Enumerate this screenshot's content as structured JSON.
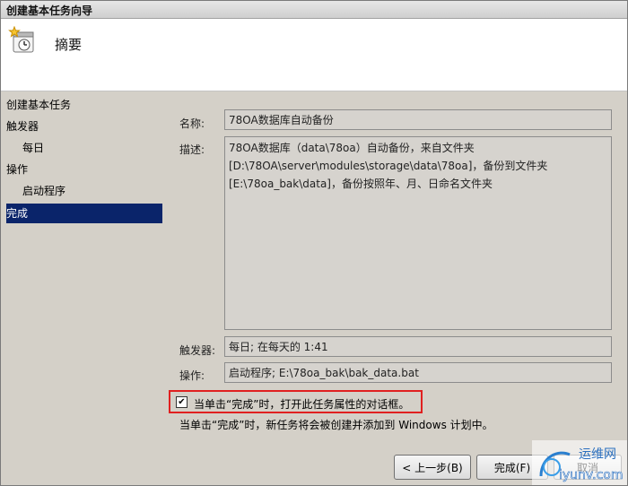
{
  "window": {
    "title": "创建基本任务向导"
  },
  "header": {
    "title": "摘要",
    "icon": "scheduled-task-wizard-icon"
  },
  "sidebar": {
    "items": [
      {
        "label": "创建基本任务"
      },
      {
        "label": "触发器"
      },
      {
        "label": "每日"
      },
      {
        "label": "操作"
      },
      {
        "label": "启动程序"
      },
      {
        "label": "完成"
      }
    ]
  },
  "summary": {
    "name_label": "名称:",
    "name_value": "78OA数据库自动备份",
    "desc_label": "描述:",
    "desc_value": "78OA数据库（data\\78oa）自动备份，来自文件夹[D:\\78OA\\server\\modules\\storage\\data\\78oa]，备份到文件夹[E:\\78oa_bak\\data]，备份按照年、月、日命名文件夹",
    "trigger_label": "触发器:",
    "trigger_value": "每日; 在每天的 1:41",
    "action_label": "操作:",
    "action_value": "启动程序; E:\\78oa_bak\\bak_data.bat"
  },
  "open_properties": {
    "checked": true,
    "label": "当单击“完成”时，打开此任务属性的对话框。"
  },
  "note": "当单击“完成”时，新任务将会被创建并添加到 Windows 计划中。",
  "buttons": {
    "back": "< 上一步(B)",
    "finish": "完成(F)",
    "cancel": "取消"
  },
  "watermark": {
    "line1": "运维网",
    "line2": "iyunv.com"
  },
  "colors": {
    "selected_bg": "#0a246a",
    "highlight_border": "#e02020"
  }
}
